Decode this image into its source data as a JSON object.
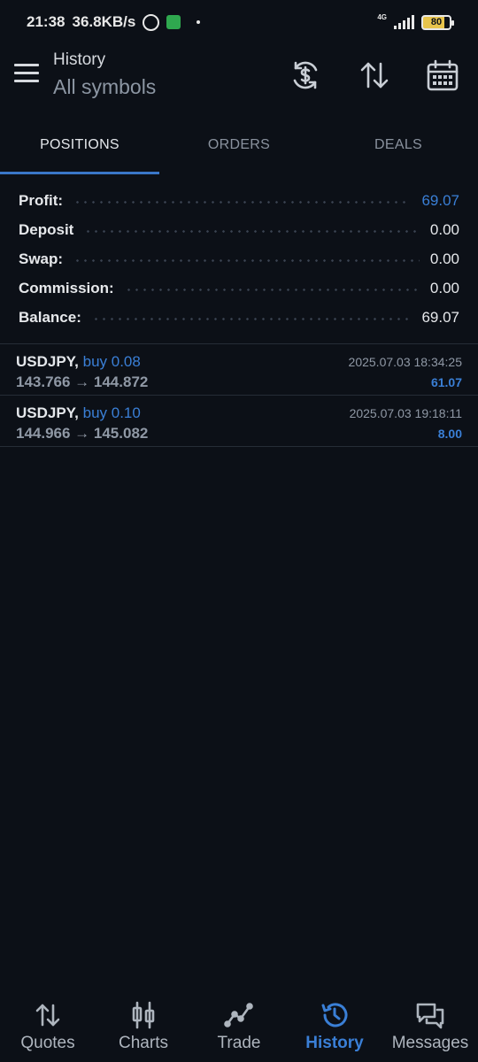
{
  "status_bar": {
    "time": "21:38",
    "speed": "36.8KB/s",
    "network": "4G",
    "battery": "80"
  },
  "header": {
    "title": "History",
    "subtitle": "All symbols",
    "icons": [
      "currency-exchange-icon",
      "sort-icon",
      "calendar-icon"
    ]
  },
  "tabs": [
    {
      "label": "POSITIONS",
      "active": true
    },
    {
      "label": "ORDERS",
      "active": false
    },
    {
      "label": "DEALS",
      "active": false
    }
  ],
  "summary": [
    {
      "label": "Profit:",
      "value": "69.07"
    },
    {
      "label": "Deposit",
      "value": "0.00"
    },
    {
      "label": "Swap:",
      "value": "0.00"
    },
    {
      "label": "Commission:",
      "value": "0.00"
    },
    {
      "label": "Balance:",
      "value": "69.07"
    }
  ],
  "positions": [
    {
      "symbol": "USDJPY,",
      "side": "buy 0.08",
      "prices": "143.766 → 144.872",
      "time": "2025.07.03 18:34:25",
      "profit": "61.07"
    },
    {
      "symbol": "USDJPY,",
      "side": "buy 0.10",
      "prices": "144.966 → 145.082",
      "time": "2025.07.03 19:18:11",
      "profit": "8.00"
    }
  ],
  "bottom_nav": [
    {
      "label": "Quotes",
      "icon": "quotes-arrows-icon",
      "active": false
    },
    {
      "label": "Charts",
      "icon": "candlestick-icon",
      "active": false
    },
    {
      "label": "Trade",
      "icon": "trade-line-icon",
      "active": false
    },
    {
      "label": "History",
      "icon": "history-clock-icon",
      "active": true
    },
    {
      "label": "Messages",
      "icon": "chat-bubbles-icon",
      "active": false
    }
  ],
  "colors": {
    "background": "#0c1017",
    "accent": "#3a7fd6",
    "divider": "#262d37"
  }
}
